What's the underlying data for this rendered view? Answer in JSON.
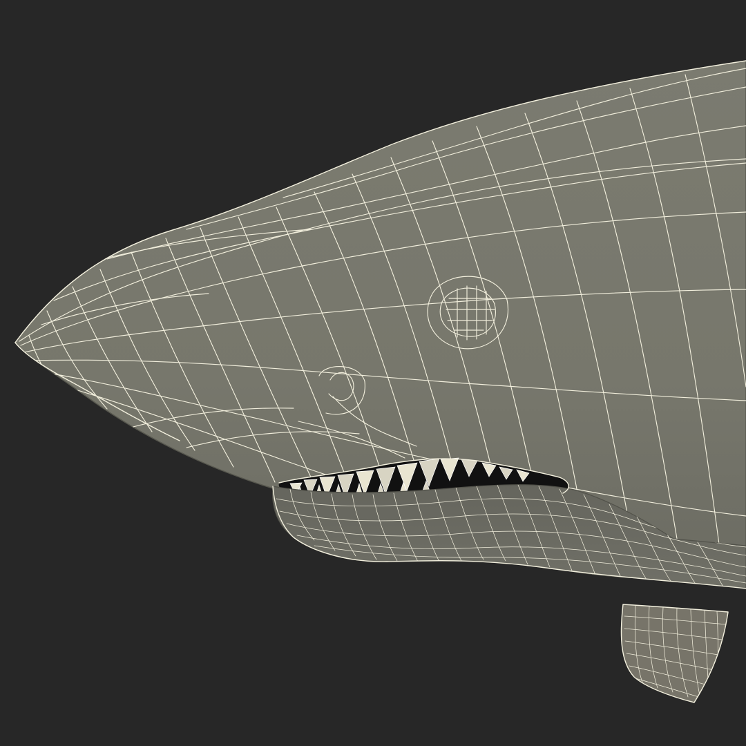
{
  "scene": {
    "subject": "shark-head",
    "mode": "wireframe-over-solid",
    "background_color": "#272727",
    "surface_color": "#77776c",
    "surface_shadow_color": "#61615a",
    "wire_color": "#f1eedc",
    "mouth_color": "#111111",
    "tooth_color": "#e9e5d1"
  }
}
